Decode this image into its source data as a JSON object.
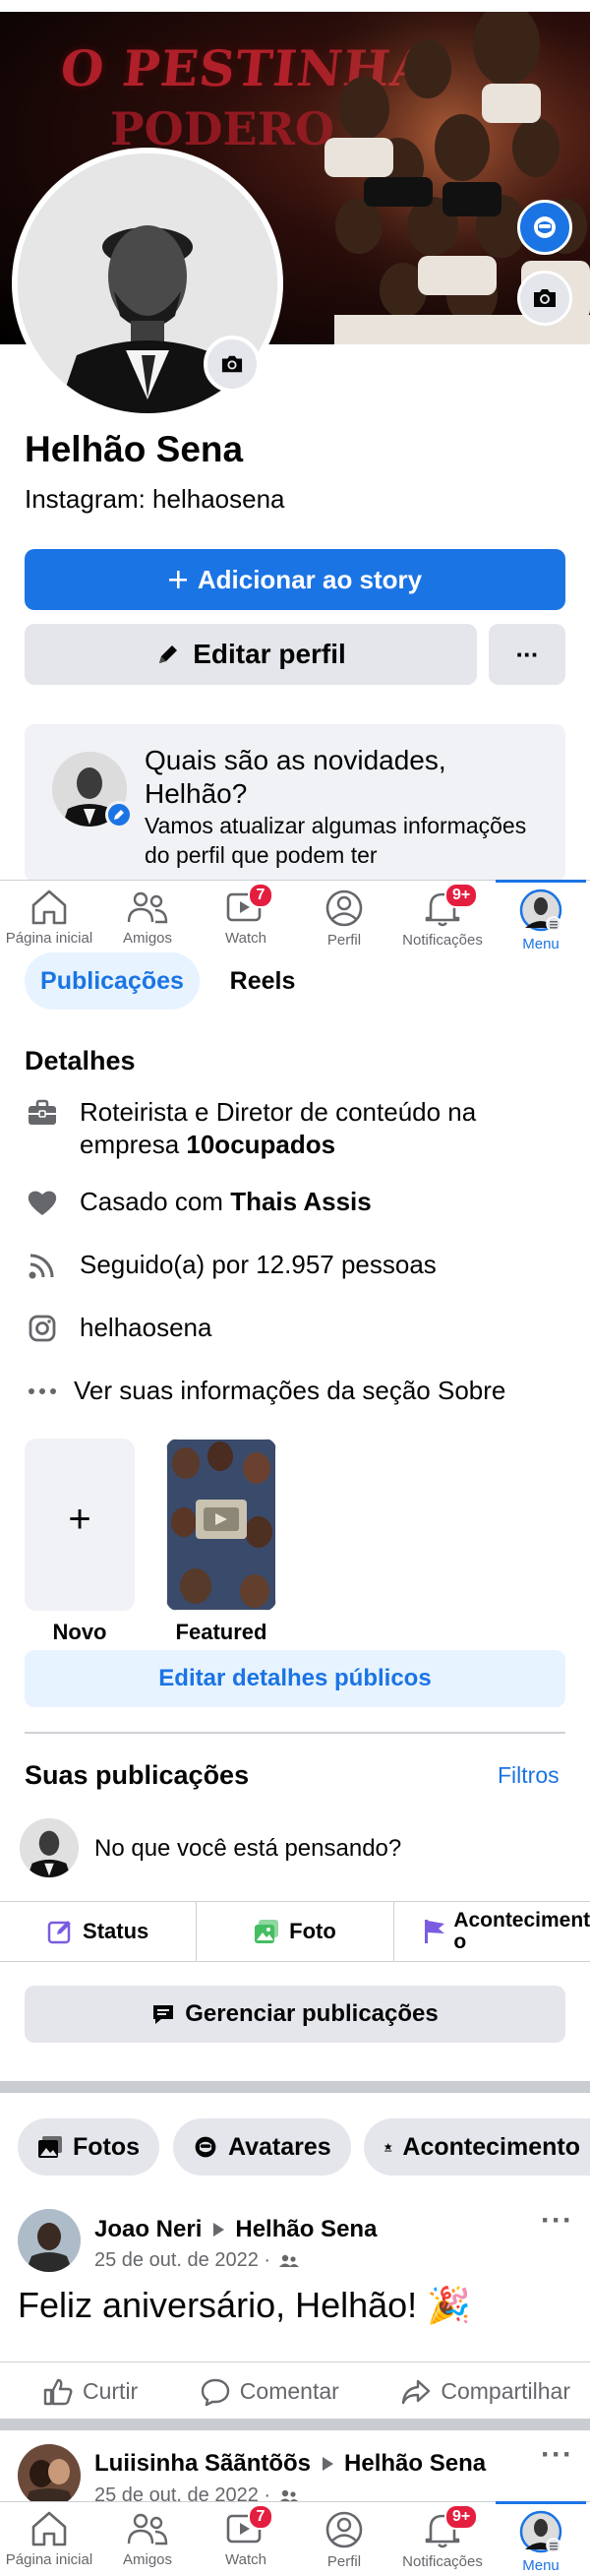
{
  "cover": {
    "title_line1": "O PESTINHA",
    "title_line2": "PODERO"
  },
  "profile": {
    "name": "Helhão Sena",
    "subtitle": "Instagram: helhaosena"
  },
  "buttons": {
    "add_story": "Adicionar ao story",
    "edit_profile": "Editar perfil",
    "more": "···"
  },
  "news_card": {
    "title": "Quais são as novidades, Helhão?",
    "text": "Vamos atualizar algumas informações do perfil que podem ter",
    "text_cut": "..."
  },
  "tabbar": {
    "items": [
      {
        "label": "Página inicial",
        "icon": "home-icon"
      },
      {
        "label": "Amigos",
        "icon": "friends-icon"
      },
      {
        "label": "Watch",
        "icon": "watch-icon",
        "badge": "7"
      },
      {
        "label": "Perfil",
        "icon": "profile-icon"
      },
      {
        "label": "Notificações",
        "icon": "bell-icon",
        "badge": "9+"
      },
      {
        "label": "Menu",
        "icon": "menu-avatar-icon"
      }
    ]
  },
  "profile_tabs": {
    "posts": "Publicações",
    "reels": "Reels"
  },
  "details": {
    "heading": "Detalhes",
    "work_prefix": "Roteirista e Diretor de conteúdo na empresa ",
    "work_company": "10ocupados",
    "relationship_prefix": "Casado com ",
    "relationship_partner": "Thais Assis",
    "followers": "Seguido(a) por 12.957 pessoas",
    "instagram": "helhaosena",
    "see_about": "Ver suas informações da seção Sobre"
  },
  "featured": {
    "new_label": "Novo",
    "featured_label": "Featured",
    "plus": "+"
  },
  "edit_public": "Editar detalhes públicos",
  "your_posts": {
    "heading": "Suas publicações",
    "filters": "Filtros",
    "composer_placeholder": "No que você está pensando?"
  },
  "post_actions": {
    "status": "Status",
    "photo": "Foto",
    "event": "Aconteciment o"
  },
  "manage_posts": "Gerenciar publicações",
  "chips": {
    "photos": "Fotos",
    "avatars": "Avatares",
    "events": "Acontecimento"
  },
  "posts": [
    {
      "author": "Joao Neri",
      "target": "Helhão Sena",
      "date": "25 de out. de 2022 ·",
      "text": "Feliz aniversário, Helhão! 🎉"
    },
    {
      "author": "Luiisinha Sããntõõs",
      "target": "Helhão Sena",
      "date": "25 de out. de 2022 ·"
    }
  ],
  "reactions": {
    "like": "Curtir",
    "comment": "Comentar",
    "share": "Compartilhar"
  },
  "colors": {
    "accent": "#1b74e4",
    "badge": "#e41e3f",
    "pill_bg": "#e7f3ff"
  }
}
